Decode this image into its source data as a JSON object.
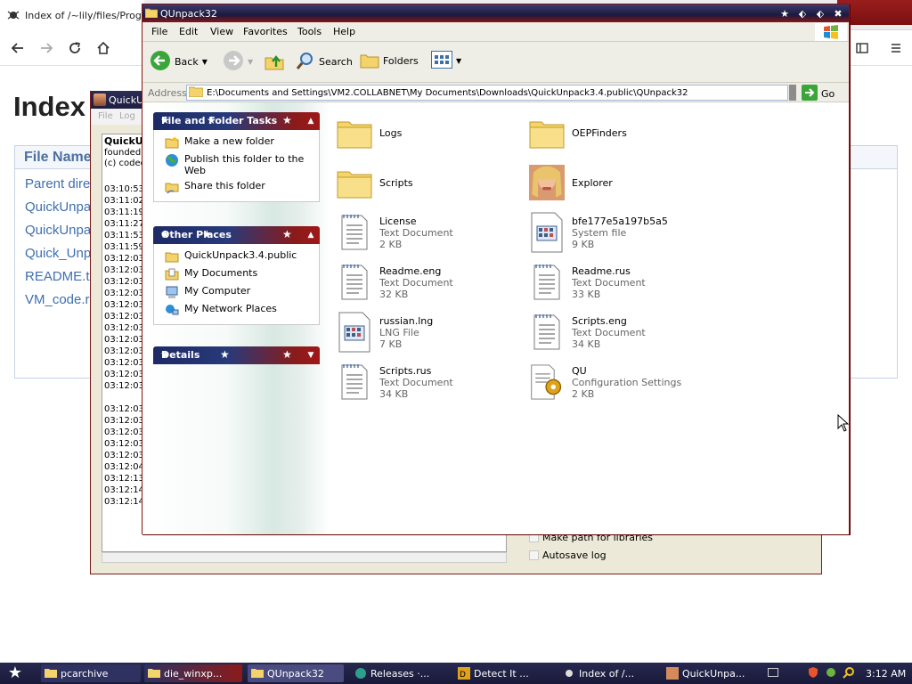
{
  "browser": {
    "tab_title": "Index of /~lily/files/Programs",
    "page_heading": "Index",
    "table_header": "File Name",
    "links": [
      "Parent dire",
      "QuickUnpa",
      "QuickUnpa",
      "Quick_Unp",
      "README.tx",
      "VM_code.r"
    ]
  },
  "quickunpack": {
    "title": "QuickUn",
    "menu": [
      "File",
      "Log"
    ],
    "log_head": [
      "QuickUn",
      "founded b",
      "(c) coded"
    ],
    "times": [
      "03:10:53",
      "03:11:02",
      "03:11:19",
      "03:11:27",
      "03:11:53",
      "03:11:59",
      "03:12:03",
      "03:12:03",
      "03:12:03",
      "03:12:03",
      "03:12:03",
      "03:12:03",
      "03:12:03",
      "03:12:03",
      "03:12:03",
      "03:12:03",
      "03:12:03",
      "03:12:03",
      "03:12:03",
      "03:12:03",
      "03:12:03",
      "03:12:03",
      "03:12:03",
      "03:12:04",
      "03:12:13",
      "03:12:14",
      "03:12:14"
    ],
    "checkboxes": [
      "Make path for libraries",
      "Autosave log"
    ]
  },
  "explorer": {
    "title": "QUnpack32",
    "menu": [
      "File",
      "Edit",
      "View",
      "Favorites",
      "Tools",
      "Help"
    ],
    "toolbar": {
      "back": "Back",
      "search": "Search",
      "folders": "Folders"
    },
    "address_label": "Address",
    "address": "E:\\Documents and Settings\\VM2.COLLABNET\\My Documents\\Downloads\\QuickUnpack3.4.public\\QUnpack32",
    "go": "Go",
    "panels": {
      "tasks": {
        "title": "File and Folder Tasks",
        "items": [
          "Make a new folder",
          "Publish this folder to the Web",
          "Share this folder"
        ]
      },
      "places": {
        "title": "Other Places",
        "items": [
          "QuickUnpack3.4.public",
          "My Documents",
          "My Computer",
          "My Network Places"
        ]
      },
      "details": {
        "title": "Details"
      }
    },
    "files": [
      {
        "name": "Logs",
        "type": "",
        "size": "",
        "icon": "folder-icon"
      },
      {
        "name": "OEPFinders",
        "type": "",
        "size": "",
        "icon": "folder-icon"
      },
      {
        "name": "Scripts",
        "type": "",
        "size": "",
        "icon": "folder-icon"
      },
      {
        "name": "Explorer",
        "type": "",
        "size": "",
        "icon": "photo-thumbnail-icon"
      },
      {
        "name": "License",
        "type": "Text Document",
        "size": "2 KB",
        "icon": "text-document-icon"
      },
      {
        "name": "bfe177e5a197b5a5",
        "type": "System file",
        "size": "9 KB",
        "icon": "system-file-icon"
      },
      {
        "name": "Readme.eng",
        "type": "Text Document",
        "size": "32 KB",
        "icon": "text-document-icon"
      },
      {
        "name": "Readme.rus",
        "type": "Text Document",
        "size": "33 KB",
        "icon": "text-document-icon"
      },
      {
        "name": "russian.lng",
        "type": "LNG File",
        "size": "7 KB",
        "icon": "system-file-icon"
      },
      {
        "name": "Scripts.eng",
        "type": "Text Document",
        "size": "34 KB",
        "icon": "text-document-icon"
      },
      {
        "name": "Scripts.rus",
        "type": "Text Document",
        "size": "34 KB",
        "icon": "text-document-icon"
      },
      {
        "name": "QU",
        "type": "Configuration Settings",
        "size": "2 KB",
        "icon": "config-settings-icon"
      }
    ]
  },
  "taskbar": {
    "tasks": [
      "pcarchive",
      "die_winxp...",
      "QUnpack32",
      "Releases ·...",
      "Detect It ...",
      "Index of /...",
      "QuickUnpa..."
    ],
    "clock": "3:12 AM"
  },
  "colors": {
    "accent_red": "#8a1b1b",
    "title_navy": "#1e1e40",
    "link_blue": "#3f6fb0"
  }
}
